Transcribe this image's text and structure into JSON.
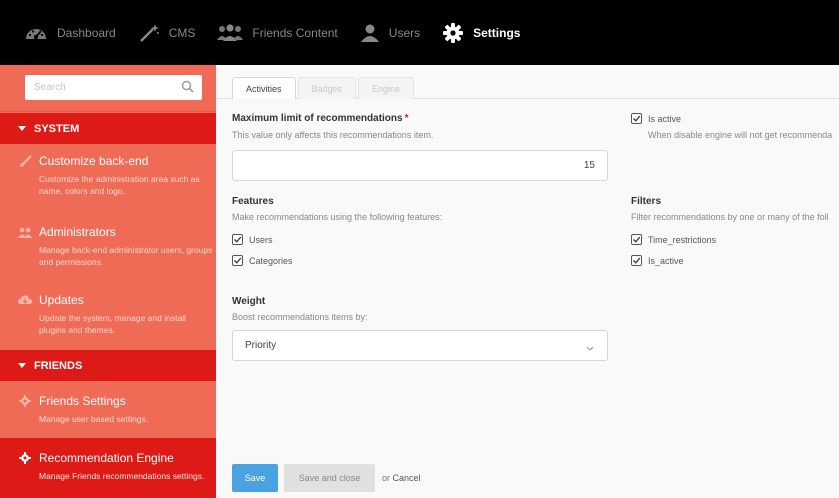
{
  "topnav": {
    "items": [
      {
        "label": "Dashboard",
        "icon": "dashboard-icon"
      },
      {
        "label": "CMS",
        "icon": "magic-wand-icon"
      },
      {
        "label": "Friends Content",
        "icon": "users-group-icon"
      },
      {
        "label": "Users",
        "icon": "user-icon"
      },
      {
        "label": "Settings",
        "icon": "gear-icon",
        "active": true
      }
    ]
  },
  "sidebar": {
    "search_placeholder": "Search",
    "sections": [
      {
        "title": "SYSTEM",
        "items": [
          {
            "title": "Customize back-end",
            "icon": "brush-icon",
            "desc": "Customize the administration area such as name, colors and logo."
          },
          {
            "title": "Administrators",
            "icon": "users-icon",
            "desc": "Manage back-end administrator users, groups and permissions."
          },
          {
            "title": "Updates",
            "icon": "cloud-download-icon",
            "desc": "Update the system, manage and install plugins and themes."
          }
        ]
      },
      {
        "title": "FRIENDS",
        "items": [
          {
            "title": "Friends Settings",
            "icon": "gear-icon",
            "desc": "Manage user based settings."
          },
          {
            "title": "Recommendation Engine",
            "icon": "gear-icon",
            "desc": "Manage Friends recommendations settings.",
            "active": true
          }
        ]
      }
    ]
  },
  "tabs": [
    "Activities",
    "Badges",
    "Engine"
  ],
  "form": {
    "max_limit": {
      "label": "Maximum limit of recommendations",
      "required_mark": "*",
      "help": "This value only affects this recommendations item.",
      "value": "15"
    },
    "is_active": {
      "label": "Is active",
      "help": "When disable engine will not get recommenda",
      "checked": true
    },
    "features": {
      "label": "Features",
      "help": "Make recommendations using the following features:",
      "options": [
        {
          "label": "Users",
          "checked": true
        },
        {
          "label": "Categories",
          "checked": true
        }
      ]
    },
    "filters": {
      "label": "Filters",
      "help": "Filter recommendations by one or many of the foll",
      "options": [
        {
          "label": "Time_restrictions",
          "checked": true
        },
        {
          "label": "Is_active",
          "checked": true
        }
      ]
    },
    "weight": {
      "label": "Weight",
      "help": "Boost recommendations items by:",
      "selected": "Priority"
    }
  },
  "actions": {
    "save": "Save",
    "save_and_close": "Save and close",
    "or": "or",
    "cancel": "Cancel"
  },
  "colors": {
    "topbar": "#000000",
    "sidebar": "#f06b56",
    "sidebar_active": "#dd1a15",
    "primary_button": "#4aa3e0"
  }
}
